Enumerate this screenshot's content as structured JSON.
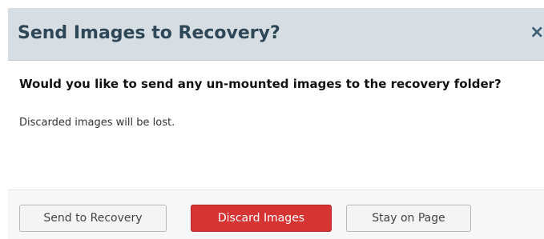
{
  "dialog": {
    "title": "Send Images to Recovery?",
    "close_icon": "×",
    "question": "Would you like to send any un-mounted images to the recovery folder?",
    "note": "Discarded images will be lost."
  },
  "buttons": {
    "send_to_recovery": "Send to Recovery",
    "discard_images": "Discard Images",
    "stay_on_page": "Stay on Page"
  },
  "colors": {
    "header_bg": "#d6dde3",
    "title_text": "#2f4656",
    "danger": "#d63333",
    "footer_bg": "#f7f7f7"
  }
}
